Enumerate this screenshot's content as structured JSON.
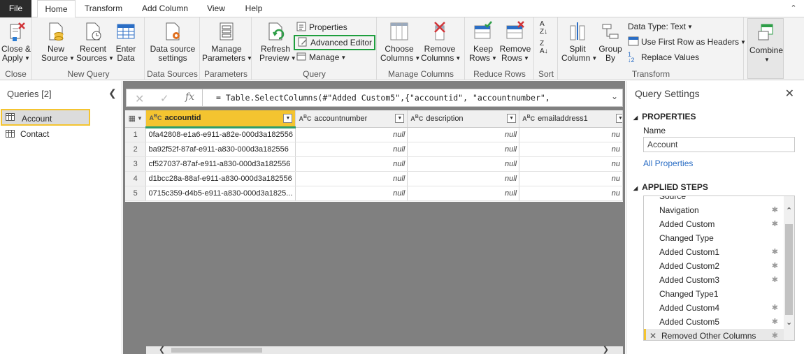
{
  "tabs": [
    "File",
    "Home",
    "Transform",
    "Add Column",
    "View",
    "Help"
  ],
  "ribbon": {
    "close_apply": "Close &",
    "close_apply2": "Apply",
    "new_source": "New",
    "new_source2": "Source",
    "recent_sources": "Recent",
    "recent_sources2": "Sources",
    "enter_data": "Enter",
    "enter_data2": "Data",
    "data_source_settings": "Data source",
    "data_source_settings2": "settings",
    "manage_parameters": "Manage",
    "manage_parameters2": "Parameters",
    "refresh_preview": "Refresh",
    "refresh_preview2": "Preview",
    "properties": "Properties",
    "advanced_editor": "Advanced Editor",
    "manage": "Manage",
    "choose_columns": "Choose",
    "choose_columns2": "Columns",
    "remove_columns": "Remove",
    "remove_columns2": "Columns",
    "keep_rows": "Keep",
    "keep_rows2": "Rows",
    "remove_rows": "Remove",
    "remove_rows2": "Rows",
    "split_column": "Split",
    "split_column2": "Column",
    "group_by": "Group",
    "group_by2": "By",
    "data_type": "Data Type: Text",
    "first_row_headers": "Use First Row as Headers",
    "replace_values": "Replace Values",
    "combine": "Combine",
    "groups": {
      "close": "Close",
      "new_query": "New Query",
      "data_sources": "Data Sources",
      "parameters": "Parameters",
      "query": "Query",
      "manage_columns": "Manage Columns",
      "reduce_rows": "Reduce Rows",
      "sort": "Sort",
      "transform": "Transform"
    }
  },
  "queries": {
    "title": "Queries [2]",
    "items": [
      "Account",
      "Contact"
    ]
  },
  "formula": "= Table.SelectColumns(#\"Added Custom5\",{\"accountid\", \"accountnumber\",",
  "grid": {
    "columns": [
      "accountid",
      "accountnumber",
      "description",
      "emailaddress1"
    ],
    "rows": [
      {
        "n": "1",
        "id": "0fa42808-e1a6-e911-a82e-000d3a182556"
      },
      {
        "n": "2",
        "id": "ba92f52f-87af-e911-a830-000d3a182556"
      },
      {
        "n": "3",
        "id": "cf527037-87af-e911-a830-000d3a182556"
      },
      {
        "n": "4",
        "id": "d1bcc28a-88af-e911-a830-000d3a182556"
      },
      {
        "n": "5",
        "id": "0715c359-d4b5-e911-a830-000d3a1825..."
      }
    ],
    "null_text": "null",
    "null_trunc": "nu"
  },
  "settings": {
    "title": "Query Settings",
    "properties": "PROPERTIES",
    "name_label": "Name",
    "name_value": "Account",
    "all_properties": "All Properties",
    "applied_steps": "APPLIED STEPS",
    "steps": [
      "Source",
      "Navigation",
      "Added Custom",
      "Changed Type",
      "Added Custom1",
      "Added Custom2",
      "Added Custom3",
      "Changed Type1",
      "Added Custom4",
      "Added Custom5",
      "Removed Other Columns"
    ]
  },
  "colors": {
    "accent": "#f4c430",
    "highlight_box": "#1e9e3e",
    "selected_border": "#2f9c6a"
  }
}
